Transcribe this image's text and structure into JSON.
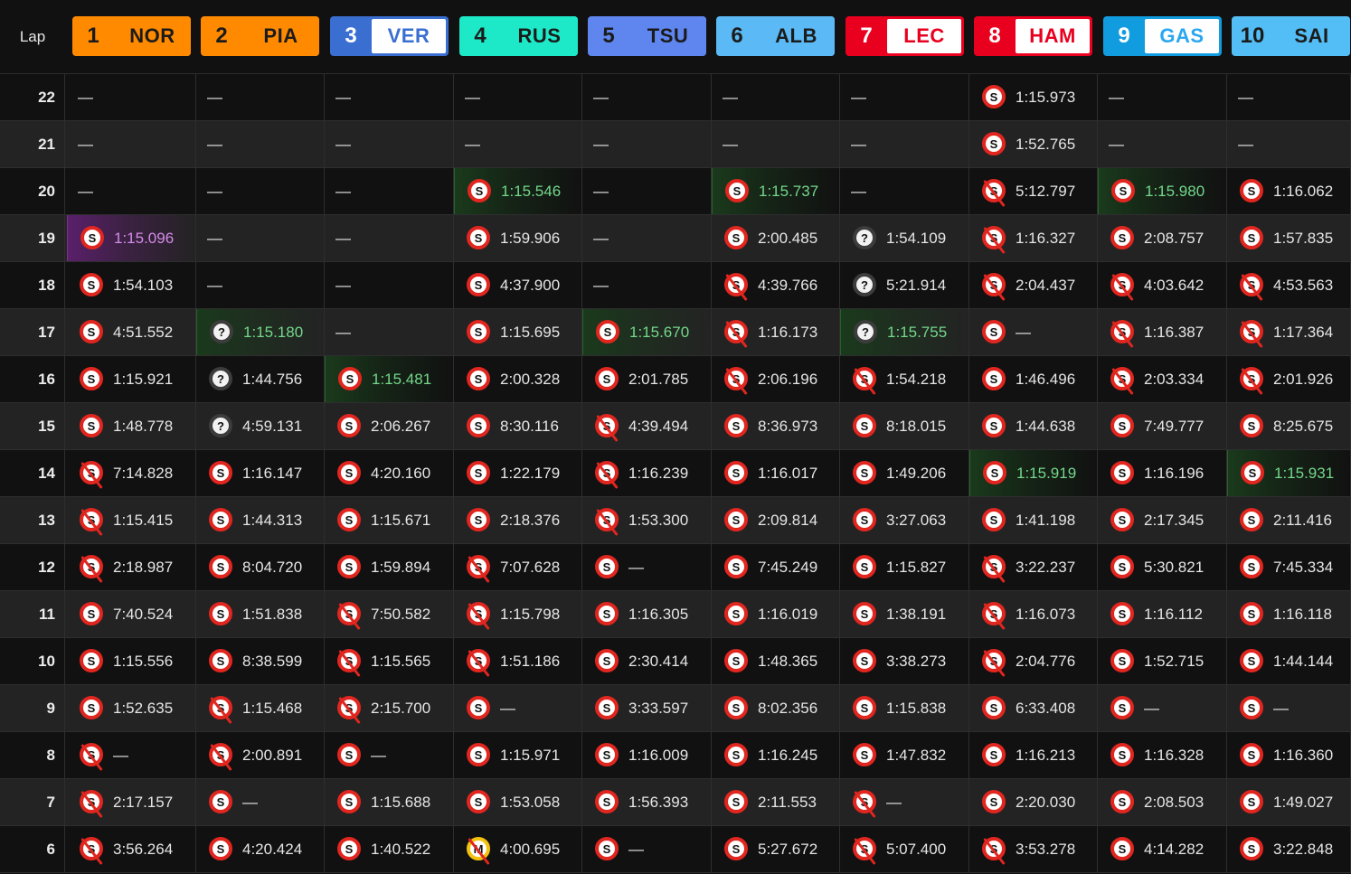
{
  "header": {
    "lap_label": "Lap"
  },
  "drivers": [
    {
      "pos": "1",
      "code": "NOR",
      "color": "#ff8a00",
      "text": "#1b1b1b"
    },
    {
      "pos": "2",
      "code": "PIA",
      "color": "#ff8a00",
      "text": "#1b1b1b"
    },
    {
      "pos": "3",
      "code": "VER",
      "color": "#3a6fd1",
      "text": "#3a6fd1"
    },
    {
      "pos": "4",
      "code": "RUS",
      "color": "#1de9c8",
      "text": "#1b1b1b"
    },
    {
      "pos": "5",
      "code": "TSU",
      "color": "#5f86ef",
      "text": "#1b1b1b"
    },
    {
      "pos": "6",
      "code": "ALB",
      "color": "#5bb9f5",
      "text": "#1b1b1b"
    },
    {
      "pos": "7",
      "code": "LEC",
      "color": "#e8001e",
      "text": "#e8001e"
    },
    {
      "pos": "8",
      "code": "HAM",
      "color": "#e8001e",
      "text": "#e8001e"
    },
    {
      "pos": "9",
      "code": "GAS",
      "color": "#119ce0",
      "text": "#2aa7f0"
    },
    {
      "pos": "10",
      "code": "SAI",
      "color": "#53bdf5",
      "text": "#1b1b1b"
    }
  ],
  "laps": [
    {
      "lap": "22",
      "cells": [
        {
          "t": "—"
        },
        {
          "t": "—"
        },
        {
          "t": "—"
        },
        {
          "t": "—"
        },
        {
          "t": "—"
        },
        {
          "t": "—"
        },
        {
          "t": "—"
        },
        {
          "tire": "S",
          "t": "1:15.973"
        },
        {
          "t": "—"
        },
        {
          "t": "—"
        }
      ]
    },
    {
      "lap": "21",
      "cells": [
        {
          "t": "—"
        },
        {
          "t": "—"
        },
        {
          "t": "—"
        },
        {
          "t": "—"
        },
        {
          "t": "—"
        },
        {
          "t": "—"
        },
        {
          "t": "—"
        },
        {
          "tire": "S",
          "t": "1:52.765"
        },
        {
          "t": "—"
        },
        {
          "t": "—"
        }
      ]
    },
    {
      "lap": "20",
      "cells": [
        {
          "t": "—"
        },
        {
          "t": "—"
        },
        {
          "t": "—"
        },
        {
          "tire": "S",
          "t": "1:15.546",
          "hl": "pb"
        },
        {
          "t": "—"
        },
        {
          "tire": "S",
          "t": "1:15.737",
          "hl": "pb"
        },
        {
          "t": "—"
        },
        {
          "tire": "S",
          "pit": true,
          "t": "5:12.797"
        },
        {
          "tire": "S",
          "t": "1:15.980",
          "hl": "pb"
        },
        {
          "tire": "S",
          "t": "1:16.062"
        }
      ]
    },
    {
      "lap": "19",
      "cells": [
        {
          "tire": "S",
          "t": "1:15.096",
          "hl": "fastest"
        },
        {
          "t": "—"
        },
        {
          "t": "—"
        },
        {
          "tire": "S",
          "t": "1:59.906"
        },
        {
          "t": "—"
        },
        {
          "tire": "S",
          "t": "2:00.485"
        },
        {
          "tire": "?",
          "t": "1:54.109"
        },
        {
          "tire": "S",
          "pit": true,
          "t": "1:16.327"
        },
        {
          "tire": "S",
          "t": "2:08.757"
        },
        {
          "tire": "S",
          "t": "1:57.835"
        }
      ]
    },
    {
      "lap": "18",
      "cells": [
        {
          "tire": "S",
          "t": "1:54.103"
        },
        {
          "t": "—"
        },
        {
          "t": "—"
        },
        {
          "tire": "S",
          "t": "4:37.900"
        },
        {
          "t": "—"
        },
        {
          "tire": "S",
          "pit": true,
          "t": "4:39.766"
        },
        {
          "tire": "?",
          "t": "5:21.914"
        },
        {
          "tire": "S",
          "pit": true,
          "t": "2:04.437"
        },
        {
          "tire": "S",
          "pit": true,
          "t": "4:03.642"
        },
        {
          "tire": "S",
          "pit": true,
          "t": "4:53.563"
        }
      ]
    },
    {
      "lap": "17",
      "cells": [
        {
          "tire": "S",
          "t": "4:51.552"
        },
        {
          "tire": "?",
          "t": "1:15.180",
          "hl": "pb"
        },
        {
          "t": "—"
        },
        {
          "tire": "S",
          "t": "1:15.695"
        },
        {
          "tire": "S",
          "t": "1:15.670",
          "hl": "pb"
        },
        {
          "tire": "S",
          "pit": true,
          "t": "1:16.173"
        },
        {
          "tire": "?",
          "t": "1:15.755",
          "hl": "pb"
        },
        {
          "tire": "S",
          "t": "—"
        },
        {
          "tire": "S",
          "pit": true,
          "t": "1:16.387"
        },
        {
          "tire": "S",
          "pit": true,
          "t": "1:17.364"
        }
      ]
    },
    {
      "lap": "16",
      "cells": [
        {
          "tire": "S",
          "t": "1:15.921"
        },
        {
          "tire": "?",
          "t": "1:44.756"
        },
        {
          "tire": "S",
          "t": "1:15.481",
          "hl": "pb"
        },
        {
          "tire": "S",
          "t": "2:00.328"
        },
        {
          "tire": "S",
          "t": "2:01.785"
        },
        {
          "tire": "S",
          "pit": true,
          "t": "2:06.196"
        },
        {
          "tire": "S",
          "pit": true,
          "t": "1:54.218"
        },
        {
          "tire": "S",
          "t": "1:46.496"
        },
        {
          "tire": "S",
          "pit": true,
          "t": "2:03.334"
        },
        {
          "tire": "S",
          "pit": true,
          "t": "2:01.926"
        }
      ]
    },
    {
      "lap": "15",
      "cells": [
        {
          "tire": "S",
          "t": "1:48.778"
        },
        {
          "tire": "?",
          "t": "4:59.131"
        },
        {
          "tire": "S",
          "t": "2:06.267"
        },
        {
          "tire": "S",
          "t": "8:30.116"
        },
        {
          "tire": "S",
          "pit": true,
          "t": "4:39.494"
        },
        {
          "tire": "S",
          "t": "8:36.973"
        },
        {
          "tire": "S",
          "t": "8:18.015"
        },
        {
          "tire": "S",
          "t": "1:44.638"
        },
        {
          "tire": "S",
          "t": "7:49.777"
        },
        {
          "tire": "S",
          "t": "8:25.675"
        }
      ]
    },
    {
      "lap": "14",
      "cells": [
        {
          "tire": "S",
          "pit": true,
          "t": "7:14.828"
        },
        {
          "tire": "S",
          "t": "1:16.147"
        },
        {
          "tire": "S",
          "t": "4:20.160"
        },
        {
          "tire": "S",
          "t": "1:22.179"
        },
        {
          "tire": "S",
          "pit": true,
          "t": "1:16.239"
        },
        {
          "tire": "S",
          "t": "1:16.017"
        },
        {
          "tire": "S",
          "t": "1:49.206"
        },
        {
          "tire": "S",
          "t": "1:15.919",
          "hl": "pb"
        },
        {
          "tire": "S",
          "t": "1:16.196"
        },
        {
          "tire": "S",
          "t": "1:15.931",
          "hl": "pb"
        }
      ]
    },
    {
      "lap": "13",
      "cells": [
        {
          "tire": "S",
          "pit": true,
          "t": "1:15.415"
        },
        {
          "tire": "S",
          "t": "1:44.313"
        },
        {
          "tire": "S",
          "t": "1:15.671"
        },
        {
          "tire": "S",
          "t": "2:18.376"
        },
        {
          "tire": "S",
          "pit": true,
          "t": "1:53.300"
        },
        {
          "tire": "S",
          "t": "2:09.814"
        },
        {
          "tire": "S",
          "t": "3:27.063"
        },
        {
          "tire": "S",
          "t": "1:41.198"
        },
        {
          "tire": "S",
          "t": "2:17.345"
        },
        {
          "tire": "S",
          "t": "2:11.416"
        }
      ]
    },
    {
      "lap": "12",
      "cells": [
        {
          "tire": "S",
          "pit": true,
          "t": "2:18.987"
        },
        {
          "tire": "S",
          "t": "8:04.720"
        },
        {
          "tire": "S",
          "t": "1:59.894"
        },
        {
          "tire": "S",
          "pit": true,
          "t": "7:07.628"
        },
        {
          "tire": "S",
          "t": "—"
        },
        {
          "tire": "S",
          "t": "7:45.249"
        },
        {
          "tire": "S",
          "t": "1:15.827"
        },
        {
          "tire": "S",
          "pit": true,
          "t": "3:22.237"
        },
        {
          "tire": "S",
          "t": "5:30.821"
        },
        {
          "tire": "S",
          "t": "7:45.334"
        }
      ]
    },
    {
      "lap": "11",
      "cells": [
        {
          "tire": "S",
          "t": "7:40.524"
        },
        {
          "tire": "S",
          "t": "1:51.838"
        },
        {
          "tire": "S",
          "pit": true,
          "t": "7:50.582"
        },
        {
          "tire": "S",
          "pit": true,
          "t": "1:15.798"
        },
        {
          "tire": "S",
          "t": "1:16.305"
        },
        {
          "tire": "S",
          "t": "1:16.019"
        },
        {
          "tire": "S",
          "t": "1:38.191"
        },
        {
          "tire": "S",
          "pit": true,
          "t": "1:16.073"
        },
        {
          "tire": "S",
          "t": "1:16.112"
        },
        {
          "tire": "S",
          "t": "1:16.118"
        }
      ]
    },
    {
      "lap": "10",
      "cells": [
        {
          "tire": "S",
          "t": "1:15.556"
        },
        {
          "tire": "S",
          "t": "8:38.599"
        },
        {
          "tire": "S",
          "pit": true,
          "t": "1:15.565"
        },
        {
          "tire": "S",
          "pit": true,
          "t": "1:51.186"
        },
        {
          "tire": "S",
          "t": "2:30.414"
        },
        {
          "tire": "S",
          "t": "1:48.365"
        },
        {
          "tire": "S",
          "t": "3:38.273"
        },
        {
          "tire": "S",
          "pit": true,
          "t": "2:04.776"
        },
        {
          "tire": "S",
          "t": "1:52.715"
        },
        {
          "tire": "S",
          "t": "1:44.144"
        }
      ]
    },
    {
      "lap": "9",
      "cells": [
        {
          "tire": "S",
          "t": "1:52.635"
        },
        {
          "tire": "S",
          "pit": true,
          "t": "1:15.468"
        },
        {
          "tire": "S",
          "pit": true,
          "t": "2:15.700"
        },
        {
          "tire": "S",
          "t": "—"
        },
        {
          "tire": "S",
          "t": "3:33.597"
        },
        {
          "tire": "S",
          "t": "8:02.356"
        },
        {
          "tire": "S",
          "t": "1:15.838"
        },
        {
          "tire": "S",
          "t": "6:33.408"
        },
        {
          "tire": "S",
          "t": "—"
        },
        {
          "tire": "S",
          "t": "—"
        }
      ]
    },
    {
      "lap": "8",
      "cells": [
        {
          "tire": "S",
          "pit": true,
          "t": "—"
        },
        {
          "tire": "S",
          "pit": true,
          "t": "2:00.891"
        },
        {
          "tire": "S",
          "t": "—"
        },
        {
          "tire": "S",
          "t": "1:15.971"
        },
        {
          "tire": "S",
          "t": "1:16.009"
        },
        {
          "tire": "S",
          "t": "1:16.245"
        },
        {
          "tire": "S",
          "t": "1:47.832"
        },
        {
          "tire": "S",
          "t": "1:16.213"
        },
        {
          "tire": "S",
          "t": "1:16.328"
        },
        {
          "tire": "S",
          "t": "1:16.360"
        }
      ]
    },
    {
      "lap": "7",
      "cells": [
        {
          "tire": "S",
          "pit": true,
          "t": "2:17.157"
        },
        {
          "tire": "S",
          "t": "—"
        },
        {
          "tire": "S",
          "t": "1:15.688"
        },
        {
          "tire": "S",
          "t": "1:53.058"
        },
        {
          "tire": "S",
          "t": "1:56.393"
        },
        {
          "tire": "S",
          "t": "2:11.553"
        },
        {
          "tire": "S",
          "pit": true,
          "t": "—"
        },
        {
          "tire": "S",
          "t": "2:20.030"
        },
        {
          "tire": "S",
          "t": "2:08.503"
        },
        {
          "tire": "S",
          "t": "1:49.027"
        }
      ]
    },
    {
      "lap": "6",
      "cells": [
        {
          "tire": "S",
          "pit": true,
          "t": "3:56.264"
        },
        {
          "tire": "S",
          "t": "4:20.424"
        },
        {
          "tire": "S",
          "t": "1:40.522"
        },
        {
          "tire": "M",
          "pit": true,
          "t": "4:00.695"
        },
        {
          "tire": "S",
          "t": "—"
        },
        {
          "tire": "S",
          "t": "5:27.672"
        },
        {
          "tire": "S",
          "pit": true,
          "t": "5:07.400"
        },
        {
          "tire": "S",
          "pit": true,
          "t": "3:53.278"
        },
        {
          "tire": "S",
          "t": "4:14.282"
        },
        {
          "tire": "S",
          "t": "3:22.848"
        }
      ]
    }
  ]
}
